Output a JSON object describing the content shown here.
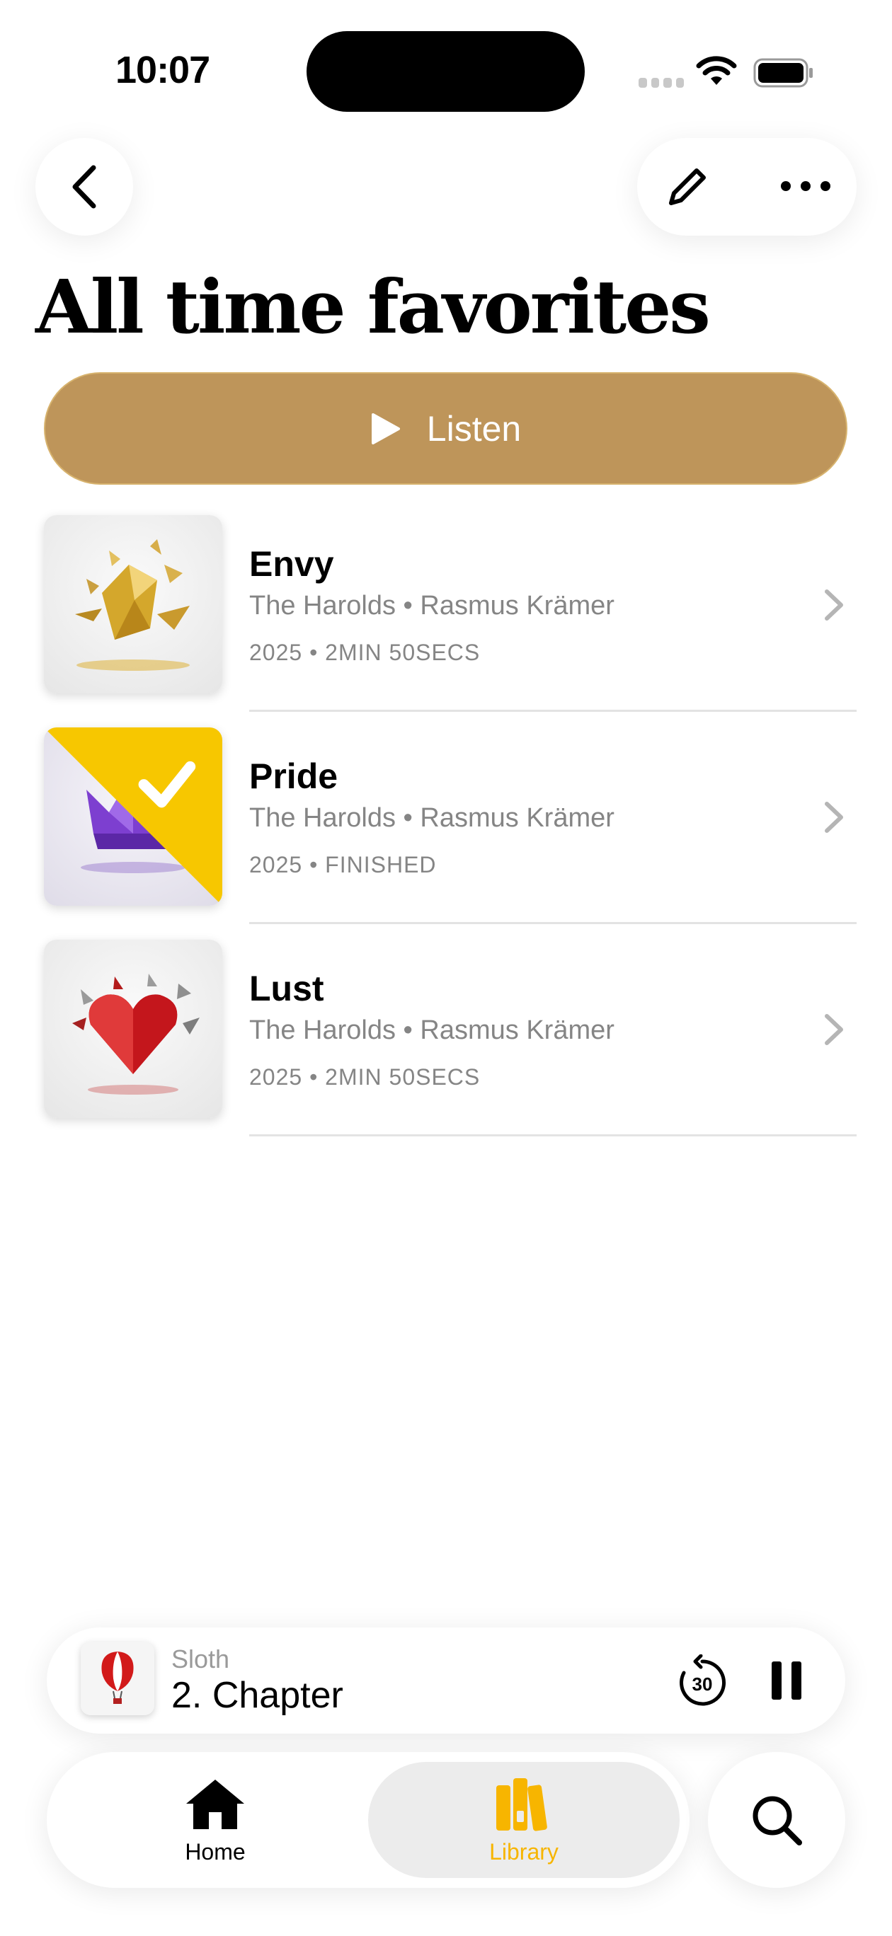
{
  "status_bar": {
    "time": "10:07",
    "wifi_icon": "wifi-icon",
    "battery_icon": "battery-icon"
  },
  "header": {
    "back_icon": "chevron-left-icon",
    "edit_icon": "pencil-icon",
    "more_icon": "ellipsis-icon",
    "title": "All time favorites"
  },
  "listen_button": {
    "label": "Listen",
    "icon": "play-icon",
    "color": "#be955a"
  },
  "books": [
    {
      "title": "Envy",
      "authors": "The Harolds • Rasmus Krämer",
      "meta": "2025 • 2MIN 50SECS",
      "finished": false,
      "cover": "golden-crystal-shards"
    },
    {
      "title": "Pride",
      "authors": "The Harolds • Rasmus Krämer",
      "meta": "2025 • FINISHED",
      "finished": true,
      "cover": "purple-crystal-crown"
    },
    {
      "title": "Lust",
      "authors": "The Harolds • Rasmus Krämer",
      "meta": "2025 • 2MIN 50SECS",
      "finished": false,
      "cover": "red-crystal-heart"
    }
  ],
  "mini_player": {
    "subtitle": "Sloth",
    "title": "2. Chapter",
    "skip_label": "30",
    "cover": "hot-air-balloon"
  },
  "tabs": [
    {
      "label": "Home",
      "icon": "house-icon",
      "active": false
    },
    {
      "label": "Library",
      "icon": "books-icon",
      "active": true
    }
  ],
  "search_icon": "magnifier-icon",
  "accent_color": "#f7b500"
}
